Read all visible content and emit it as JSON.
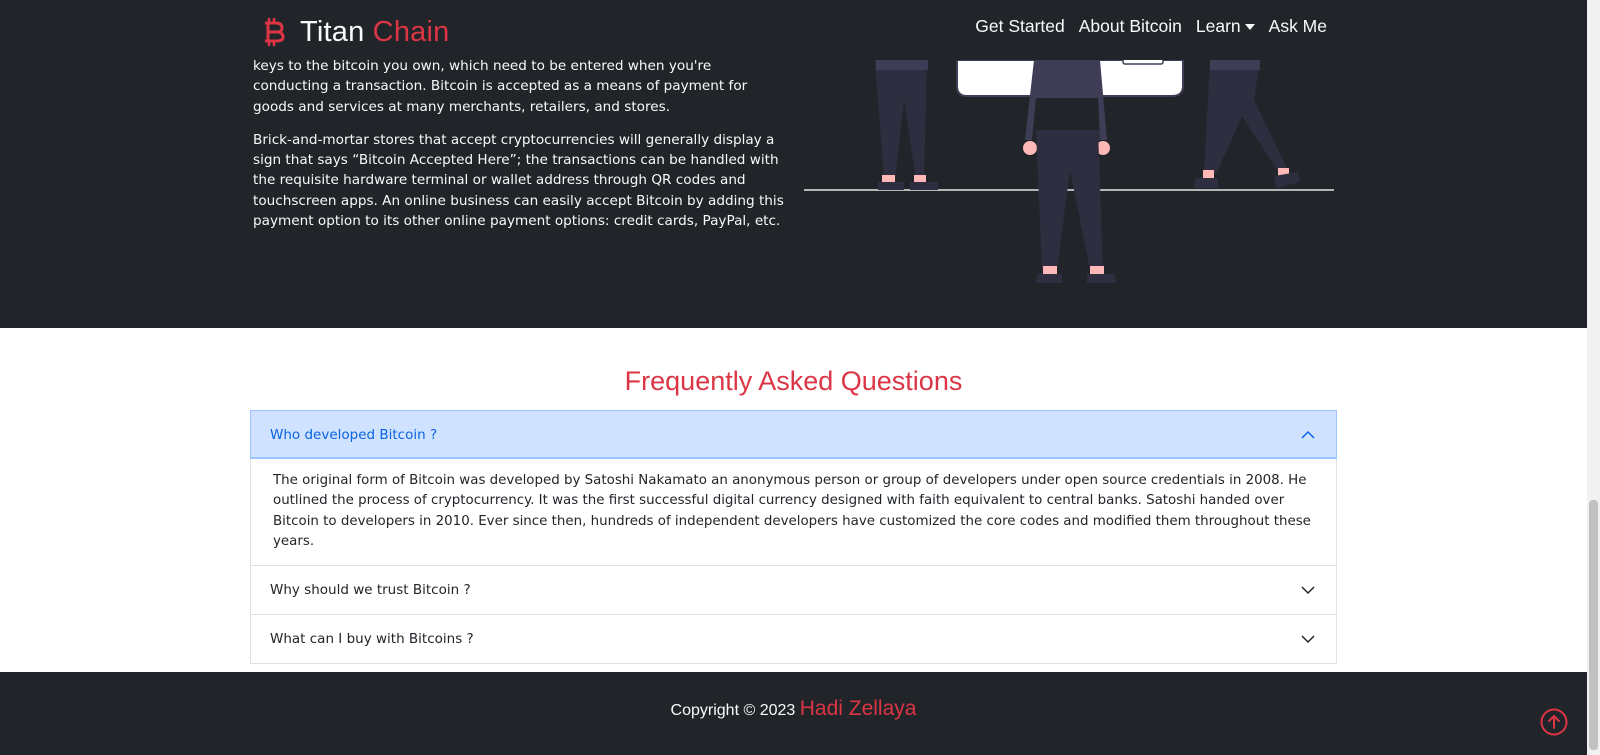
{
  "navbar": {
    "brand_name": "Titan",
    "brand_accent": "Chain",
    "brand_icon": "bitcoin-icon",
    "links": [
      "Get Started",
      "About Bitcoin",
      "Learn",
      "Ask Me"
    ]
  },
  "hero": {
    "paragraph_1": "keys to the bitcoin you own, which need to be entered when you're conducting a transaction. Bitcoin is accepted as a means of payment for goods and services at many merchants, retailers, and stores.",
    "paragraph_2": "Brick-and-mortar stores that accept cryptocurrencies will generally display a sign that says “Bitcoin Accepted Here”; the transactions can be handled with the requisite hardware terminal or wallet address through QR codes and touchscreen apps. An online business can easily accept Bitcoin by adding this payment option to its other online payment options: credit cards, PayPal, etc."
  },
  "faq": {
    "title": "Frequently Asked Questions",
    "items": [
      {
        "question": "Who developed Bitcoin ?",
        "answer": "The original form of Bitcoin was developed by Satoshi Nakamato an anonymous person or group of developers under open source credentials in 2008. He outlined the process of cryptocurrency. It was the first successful digital currency designed with faith equivalent to central banks. Satoshi handed over Bitcoin to developers in 2010. Ever since then, hundreds of independent developers have customized the core codes and modified them throughout these years.",
        "expanded": true
      },
      {
        "question": "Why should we trust Bitcoin ?",
        "expanded": false
      },
      {
        "question": "What can I buy with Bitcoins ?",
        "expanded": false
      }
    ]
  },
  "footer": {
    "copyright": "Copyright © 2023",
    "author": "Hadi Zellaya",
    "back_to_top_icon": "arrow-up-circle-icon"
  },
  "colors": {
    "accent": "#dc3545",
    "dark": "#212529",
    "active_bg": "#cfe2ff",
    "active_text": "#0c63e4"
  }
}
